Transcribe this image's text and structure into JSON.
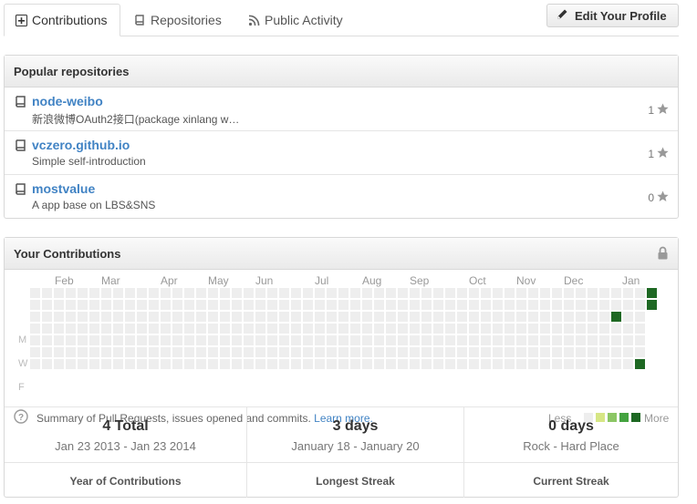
{
  "tabs": [
    {
      "label": "Contributions",
      "icon": "plus-square-icon",
      "active": true
    },
    {
      "label": "Repositories",
      "icon": "repo-book-icon",
      "active": false
    },
    {
      "label": "Public Activity",
      "icon": "rss-icon",
      "active": false
    }
  ],
  "edit_profile": {
    "label": "Edit Your Profile",
    "icon": "pencil-icon"
  },
  "popular": {
    "title": "Popular repositories",
    "repos": [
      {
        "name": "node-weibo",
        "description": "新浪微博OAuth2接口(package xinlang w…",
        "stars": "1"
      },
      {
        "name": "vczero.github.io",
        "description": "Simple self-introduction",
        "stars": "1"
      },
      {
        "name": "mostvalue",
        "description": "A app base on LBS&SNS",
        "stars": "0"
      }
    ]
  },
  "contributions": {
    "title": "Your Contributions",
    "lock_icon": "lock-icon",
    "months": [
      "Feb",
      "Mar",
      "Apr",
      "May",
      "Jun",
      "Jul",
      "Aug",
      "Sep",
      "Oct",
      "Nov",
      "Dec",
      "Jan"
    ],
    "days": [
      "M",
      "W",
      "F"
    ],
    "colors": {
      "empty": "#eeeeee",
      "l1": "#d6e685",
      "l2": "#8cc665",
      "l3": "#44a340",
      "l4": "#1e6823"
    },
    "active_cells": [
      {
        "week": 52,
        "day": 0,
        "level": 4
      },
      {
        "week": 52,
        "day": 1,
        "level": 4
      },
      {
        "week": 49,
        "day": 2,
        "level": 4
      },
      {
        "week": 51,
        "day": 6,
        "level": 4
      }
    ],
    "summary_text": "Summary of Pull Requests, issues opened and commits. ",
    "learn_more": "Learn more.",
    "legend_less": "Less",
    "legend_more": "More",
    "stats": [
      {
        "big": "4 Total",
        "sub": "Jan 23 2013 - Jan 23 2014",
        "label": "Year of Contributions"
      },
      {
        "big": "3 days",
        "sub": "January 18 - January 20",
        "label": "Longest Streak"
      },
      {
        "big": "0 days",
        "sub": "Rock - Hard Place",
        "label": "Current Streak"
      }
    ]
  }
}
